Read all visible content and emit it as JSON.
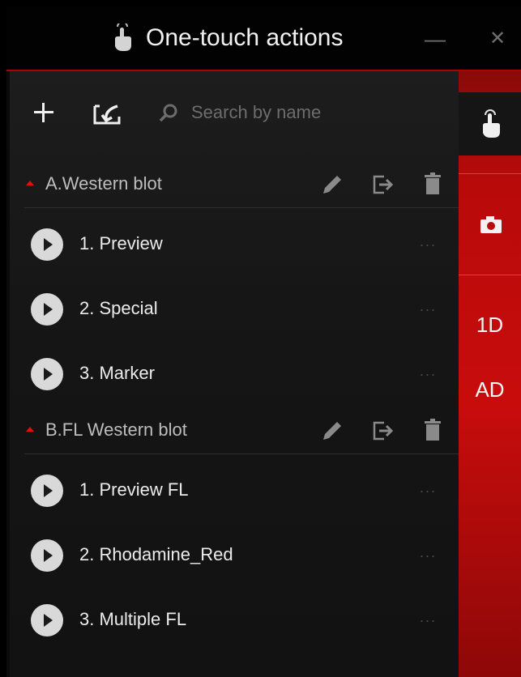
{
  "window": {
    "title": "One-touch actions",
    "minimize_glyph": "—",
    "close_glyph": "✕",
    "title_icon": "hand-tap-icon"
  },
  "toolbar": {
    "add_icon": "plus-icon",
    "import_icon": "import-icon",
    "search_icon": "search-icon",
    "search_placeholder": "Search by name",
    "search_value": ""
  },
  "groups": [
    {
      "label": "A.Western blot",
      "expanded": true,
      "actions": [
        {
          "label": "1. Preview"
        },
        {
          "label": "2. Special"
        },
        {
          "label": "3. Marker"
        }
      ]
    },
    {
      "label": "B.FL Western blot",
      "expanded": true,
      "actions": [
        {
          "label": "1. Preview FL"
        },
        {
          "label": "2. Rhodamine_Red"
        },
        {
          "label": "3. Multiple FL"
        }
      ]
    }
  ],
  "more_glyph": "...",
  "sidebar": {
    "tabs": [
      {
        "icon": "hand-tap-icon",
        "active": true
      },
      {
        "icon": "camera-icon",
        "active": false
      },
      {
        "label": "1D",
        "active": false
      },
      {
        "label": "AD",
        "active": false
      }
    ]
  },
  "colors": {
    "accent": "#c80c0c",
    "panel": "#151515",
    "titlebar": "#020202"
  }
}
